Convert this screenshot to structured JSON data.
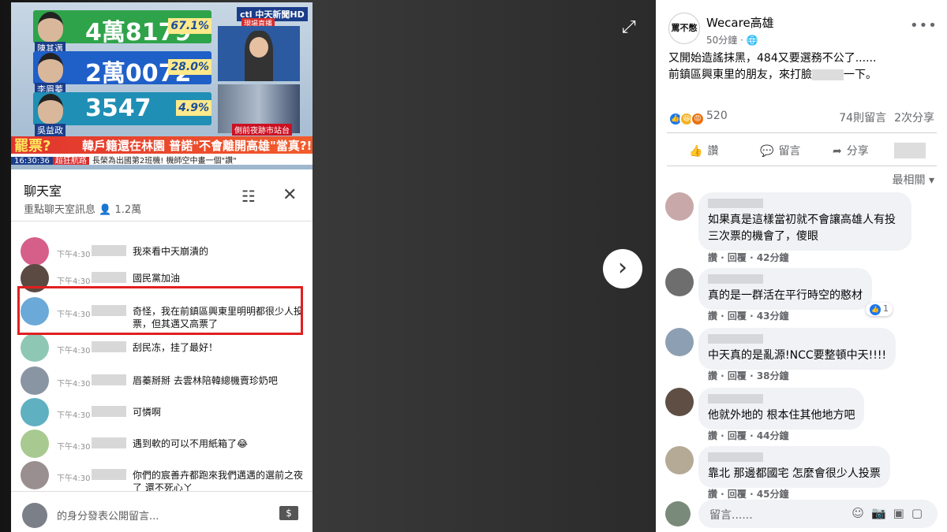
{
  "tv": {
    "brand": "ctl 中天新聞HD",
    "live_tag": "現場直播",
    "candidates": [
      {
        "name": "陳其邁",
        "votes": "4萬8179",
        "pct": "67.1%",
        "color": "#2fa34a"
      },
      {
        "name": "李眉蓁",
        "votes": "2萬0072",
        "pct": "28.0%",
        "color": "#1f5fc8"
      },
      {
        "name": "吳益政",
        "votes": "3547",
        "pct": "4.9%",
        "color": "#1f8fb5"
      }
    ],
    "crowd_caption": "側前夜跡市站台",
    "headline_left": "罷票?",
    "headline": "韓戶籍還在林園 普諾\"不會離開高雄\"當真?!",
    "ticker_time": "16:30:36",
    "ticker_label": "超狂航路",
    "ticker_text": "長榮為出國第2班機! 機師空中畫一個\"讚\""
  },
  "chat": {
    "title": "聊天室",
    "subtitle": "重點聊天室訊息",
    "viewers": "1.2萬",
    "messages": [
      {
        "time": "下午4:30",
        "text": "我來看中天崩潰的",
        "avatar": "#d65f8a"
      },
      {
        "time": "下午4:30",
        "text": "國民黨加油",
        "avatar": "#5b4a42"
      },
      {
        "time": "下午4:30",
        "text": "奇怪，我在前鎮區興東里明明都很少人投票，但其邁又高票了",
        "avatar": "#6aa9d8"
      },
      {
        "time": "下午4:30",
        "text": "刮民冻，挂了最好！",
        "avatar": "#8fc7b5"
      },
      {
        "time": "下午4:30",
        "text": "眉蓁掰掰 去雲林陪韓總機賣珍奶吧",
        "avatar": "#8a95a3"
      },
      {
        "time": "下午4:30",
        "text": "可憐啊",
        "avatar": "#5fb0c0"
      },
      {
        "time": "下午4:30",
        "text": "遇到軟的可以不用紙箱了😂",
        "avatar": "#a8c990"
      },
      {
        "time": "下午4:30",
        "text": "你們的宸善卉都跑來我們邁邁的選前之夜了 還不死心ㄚ",
        "avatar": "#9a8f90"
      }
    ],
    "composer_placeholder": "的身分發表公開留言...",
    "pay_icon": "$"
  },
  "fb": {
    "page_logo": "罵不憋",
    "page_name": "Wecare高雄",
    "time": "50分鐘 · ",
    "post_line1": "又開始造謠抹黑，484又要選務不公了......",
    "post_line2a": "前鎮區興東里的朋友，來打臉",
    "post_line2b": "一下。",
    "reaction_count": "520",
    "comments_count": "74則留言",
    "shares_count": "2次分享",
    "like_label": "讚",
    "comment_label": "留言",
    "share_label": "分享",
    "sort_label": "最相關 ▾",
    "comments": [
      {
        "text": "如果真是這樣當初就不會讓高雄人有投三次票的機會了，傻眼",
        "meta": "讚 · 回覆 · 42分鐘",
        "avatar": "#c8a8a8"
      },
      {
        "text": "真的是一群活在平行時空的憨材",
        "meta": "讚 · 回覆 · 43分鐘",
        "avatar": "#6e6e6e",
        "likes": "1"
      },
      {
        "text": "中天真的是亂源!NCC要整頓中天!!!!",
        "meta": "讚 · 回覆 · 38分鐘",
        "avatar": "#8da0b3"
      },
      {
        "text": "他就外地的 根本住其他地方吧",
        "meta": "讚 · 回覆 · 44分鐘",
        "avatar": "#5e4e44"
      },
      {
        "text": "靠北 那邊都國宅 怎麼會很少人投票",
        "meta": "讚 · 回覆 · 45分鐘",
        "avatar": "#b5aa96"
      }
    ],
    "composer_placeholder": "留言......"
  }
}
